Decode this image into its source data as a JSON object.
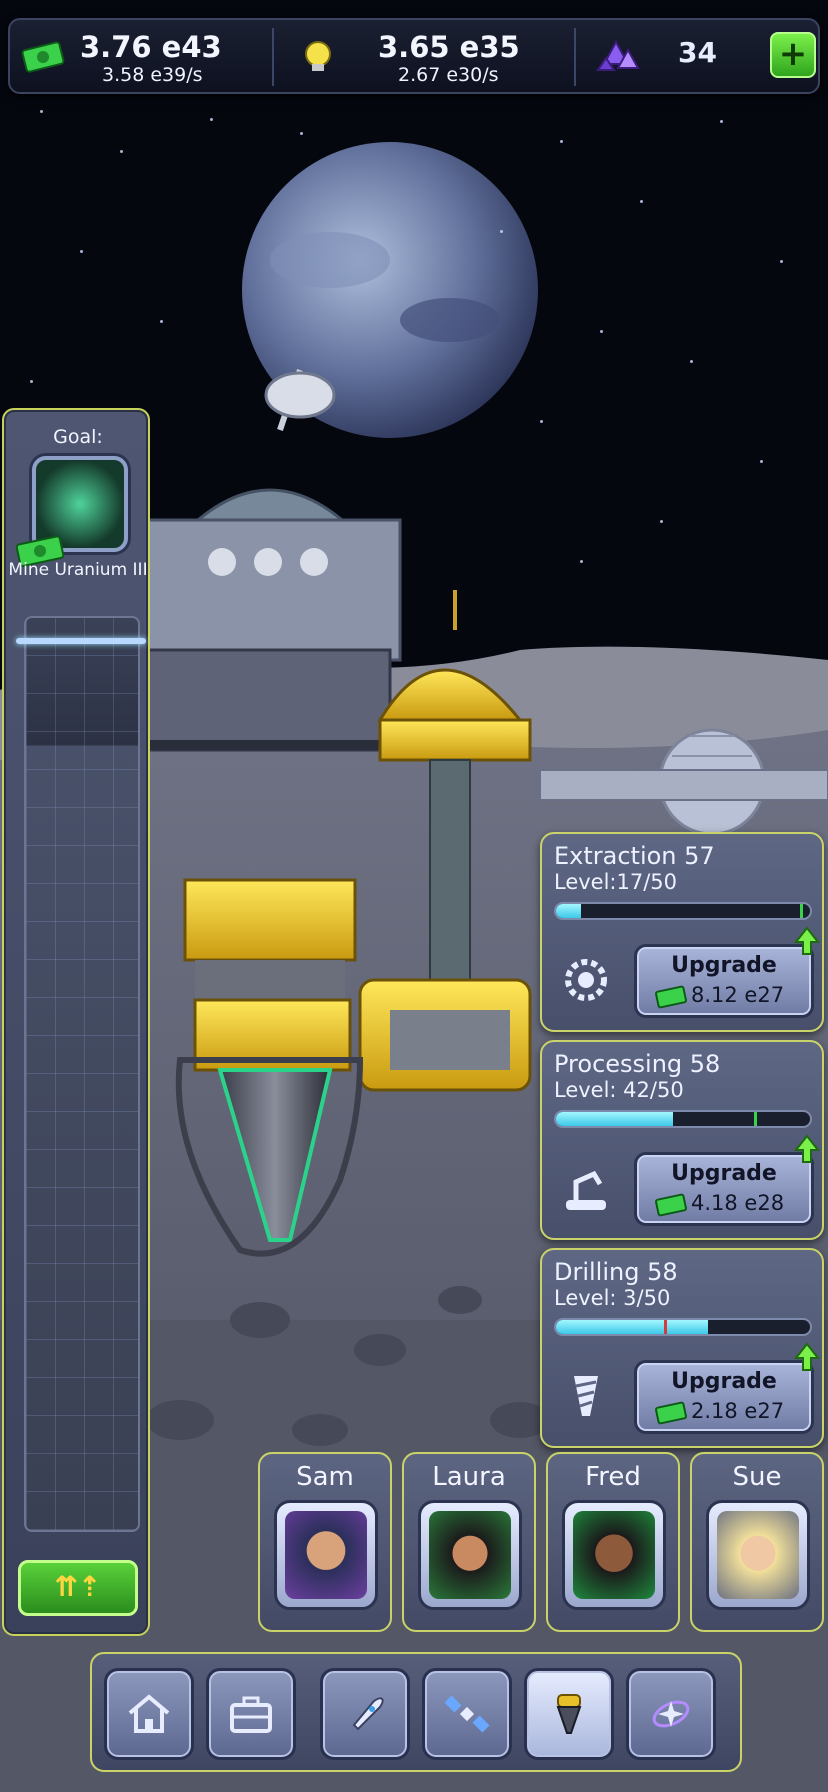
{
  "resources": {
    "cash": {
      "icon": "cash-icon",
      "value": "3.76 e43",
      "rate": "3.58 e39/s"
    },
    "research": {
      "icon": "lightbulb-icon",
      "value": "3.65 e35",
      "rate": "2.67 e30/s"
    },
    "gems": {
      "icon": "gem-cluster-icon",
      "value": "34"
    },
    "add_button": "+"
  },
  "goal": {
    "label": "Goal:",
    "name": "Mine Uranium III",
    "icon": "uranium-drill-icon",
    "boost_icon": "triple-arrow-up-icon"
  },
  "upgrades": [
    {
      "title": "Extraction 57",
      "level": "Level:17/50",
      "progress": 0.1,
      "button": "Upgrade",
      "cost": "8.12 e27",
      "icon": "gear-icon"
    },
    {
      "title": "Processing 58",
      "level": "Level: 42/50",
      "progress": 0.46,
      "button": "Upgrade",
      "cost": "4.18 e28",
      "icon": "robot-arm-icon"
    },
    {
      "title": "Drilling 58",
      "level": "Level: 3/50",
      "progress": 0.6,
      "button": "Upgrade",
      "cost": "2.18 e27",
      "icon": "drill-bit-icon"
    }
  ],
  "managers": [
    {
      "name": "Sam"
    },
    {
      "name": "Laura"
    },
    {
      "name": "Fred"
    },
    {
      "name": "Sue"
    }
  ],
  "nav": [
    {
      "icon": "home-icon"
    },
    {
      "icon": "briefcase-icon"
    },
    {
      "icon": "rocket-icon"
    },
    {
      "icon": "satellite-icon"
    },
    {
      "icon": "drill-icon",
      "active": true
    },
    {
      "icon": "star-portal-icon"
    }
  ],
  "colors": {
    "accent_border": "#c9d36a",
    "progress_fill": "#3cc9e8",
    "cash_green": "#3bd14a"
  }
}
